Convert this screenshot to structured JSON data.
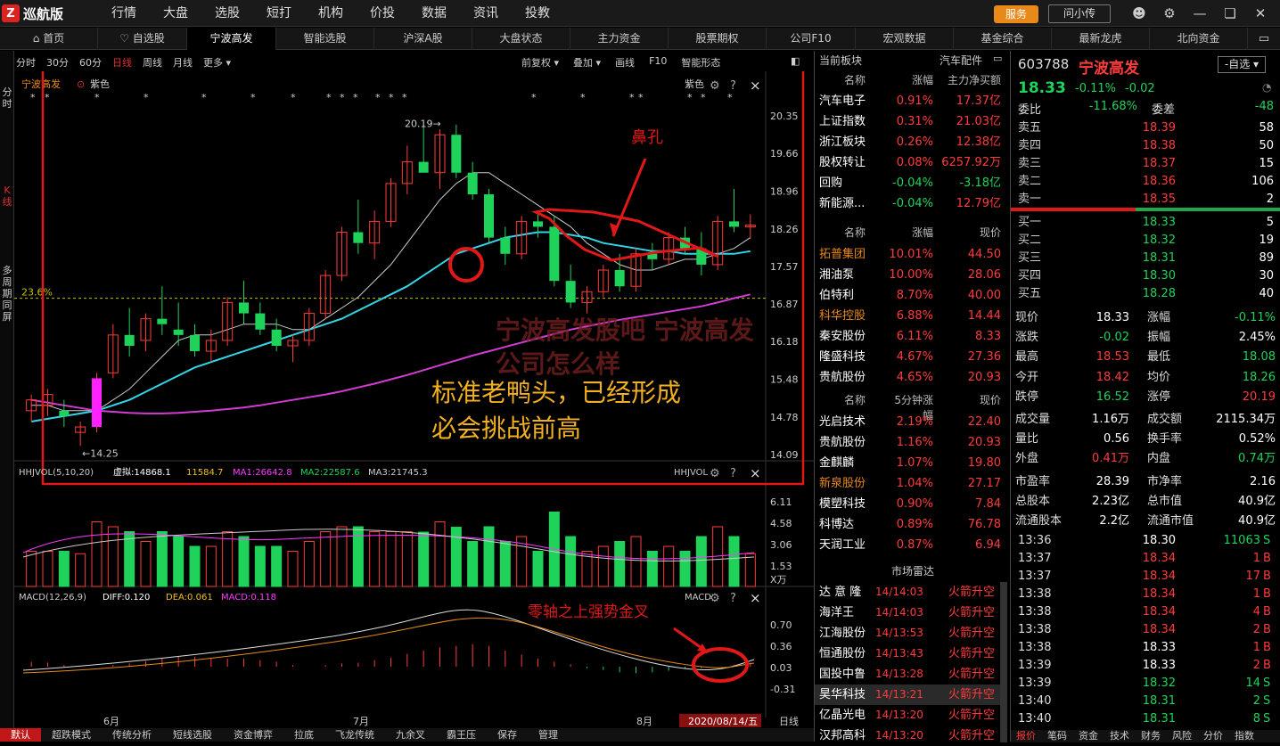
{
  "app": {
    "name": "巡航版",
    "menu": [
      "行情",
      "大盘",
      "选股",
      "短打",
      "机构",
      "价投",
      "数据",
      "资讯",
      "投教"
    ],
    "service": "服务",
    "ask": "问小传"
  },
  "tabs": [
    "首页",
    "自选股",
    "宁波高发",
    "智能选股",
    "沪深A股",
    "大盘状态",
    "主力资金",
    "股票期权",
    "公司F10",
    "宏观数据",
    "基金综合",
    "最新龙虎",
    "北向资金"
  ],
  "left_strip": [
    "分时",
    "K线",
    "多周期同屏"
  ],
  "chart_tools": {
    "periods": [
      "分时",
      "30分",
      "60分",
      "日线",
      "周线",
      "月线",
      "更多"
    ],
    "right": [
      "前复权",
      "叠加",
      "画线",
      "F10",
      "智能形态"
    ]
  },
  "main_chart": {
    "stock": "宁波高发",
    "color_label": "紫色",
    "color_label2": "紫色",
    "high_label": "20.19",
    "low_label": "14.25",
    "percent_label": "23.6%",
    "y_ticks": [
      "20.35",
      "19.66",
      "18.96",
      "18.26",
      "17.57",
      "16.87",
      "16.18",
      "15.48",
      "14.78",
      "14.09"
    ]
  },
  "vol_panel": {
    "title": "HHJVOL(5,10,20)",
    "xn": "虚拟:14868.1",
    "v1": "11584.7",
    "ma1": "MA1:26642.8",
    "ma2": "MA2:22587.6",
    "ma3": "MA3:21745.3",
    "right": "HHJVOL",
    "y_ticks": [
      "6.11",
      "4.58",
      "3.06",
      "1.53"
    ],
    "unit": "X万"
  },
  "macd_panel": {
    "title": "MACD(12,26,9)",
    "diff": "DIFF:0.120",
    "dea": "DEA:0.061",
    "macd": "MACD:0.118",
    "right": "MACD",
    "y_ticks": [
      "0.70",
      "0.36",
      "0.03",
      "-0.31"
    ]
  },
  "x_labels": [
    "6月",
    "7月",
    "8月"
  ],
  "date_label": "2020/08/14/五",
  "period_right": "日线",
  "annotations": {
    "nose": "鼻孔",
    "duckhead": "标准老鸭头，已经形成\n必会挑战前高",
    "watermark": "宁波高发股吧 宁波高发公司怎么样",
    "macd_note": "零轴之上强势金叉"
  },
  "chart_data": {
    "type": "candlestick",
    "dates": [
      "2020-05",
      "2020-06",
      "2020-07",
      "2020-08"
    ],
    "ohlc": [
      [
        14.9,
        15.2,
        14.7,
        15.1
      ],
      [
        15.0,
        15.3,
        14.8,
        15.2
      ],
      [
        14.9,
        15.1,
        14.6,
        14.8
      ],
      [
        14.5,
        14.7,
        14.25,
        14.6
      ],
      [
        14.6,
        15.6,
        14.5,
        15.5
      ],
      [
        15.6,
        16.5,
        15.5,
        16.3
      ],
      [
        16.3,
        16.8,
        15.9,
        16.1
      ],
      [
        16.2,
        16.7,
        16.0,
        16.6
      ],
      [
        16.6,
        17.2,
        16.3,
        16.5
      ],
      [
        16.4,
        16.9,
        16.1,
        16.3
      ],
      [
        16.3,
        16.5,
        15.9,
        16.0
      ],
      [
        16.0,
        16.4,
        15.8,
        16.2
      ],
      [
        16.2,
        17.0,
        16.1,
        16.9
      ],
      [
        16.9,
        17.3,
        16.5,
        16.7
      ],
      [
        16.7,
        16.9,
        16.3,
        16.4
      ],
      [
        16.4,
        16.6,
        16.0,
        16.1
      ],
      [
        16.1,
        16.3,
        15.8,
        16.2
      ],
      [
        16.2,
        16.8,
        16.1,
        16.7
      ],
      [
        16.7,
        17.5,
        16.6,
        17.4
      ],
      [
        17.4,
        18.3,
        17.3,
        18.2
      ],
      [
        18.2,
        18.8,
        17.8,
        18.0
      ],
      [
        18.0,
        18.6,
        17.7,
        18.4
      ],
      [
        18.4,
        19.2,
        18.3,
        19.1
      ],
      [
        19.1,
        19.8,
        18.9,
        19.5
      ],
      [
        19.5,
        20.19,
        19.3,
        19.3
      ],
      [
        19.3,
        20.1,
        19.0,
        20.0
      ],
      [
        20.0,
        20.19,
        19.2,
        19.3
      ],
      [
        19.3,
        19.5,
        18.8,
        18.9
      ],
      [
        18.9,
        19.0,
        18.0,
        18.1
      ],
      [
        18.1,
        18.3,
        17.6,
        17.8
      ],
      [
        17.8,
        18.5,
        17.7,
        18.4
      ],
      [
        18.4,
        18.6,
        18.1,
        18.3
      ],
      [
        18.3,
        18.5,
        17.2,
        17.3
      ],
      [
        17.3,
        17.6,
        16.8,
        16.9
      ],
      [
        16.9,
        17.2,
        16.7,
        17.1
      ],
      [
        17.1,
        17.6,
        17.0,
        17.5
      ],
      [
        17.5,
        17.8,
        17.1,
        17.2
      ],
      [
        17.2,
        17.9,
        17.1,
        17.8
      ],
      [
        17.8,
        18.0,
        17.5,
        17.7
      ],
      [
        17.7,
        18.2,
        17.6,
        18.1
      ],
      [
        18.1,
        18.3,
        17.8,
        17.9
      ],
      [
        17.9,
        18.2,
        17.4,
        17.6
      ],
      [
        17.6,
        18.5,
        17.5,
        18.4
      ],
      [
        18.4,
        19.0,
        18.2,
        18.3
      ],
      [
        18.3,
        18.53,
        18.08,
        18.33
      ]
    ],
    "ma_series": [
      {
        "color": "#cccccc",
        "values": [
          15.0,
          15.0,
          14.9,
          14.9,
          14.9,
          15.1,
          15.3,
          15.6,
          15.9,
          16.2,
          16.3,
          16.3,
          16.4,
          16.5,
          16.5,
          16.5,
          16.4,
          16.4,
          16.6,
          16.8,
          17.0,
          17.3,
          17.6,
          18.0,
          18.4,
          18.8,
          19.1,
          19.3,
          19.3,
          19.1,
          18.9,
          18.7,
          18.5,
          18.3,
          18.0,
          17.8,
          17.6,
          17.5,
          17.5,
          17.6,
          17.7,
          17.7,
          17.8,
          17.9,
          18.1
        ]
      },
      {
        "color": "#33d6e6",
        "values": [
          14.7,
          14.75,
          14.8,
          14.85,
          14.9,
          15.0,
          15.1,
          15.25,
          15.4,
          15.55,
          15.7,
          15.8,
          15.9,
          16.0,
          16.1,
          16.2,
          16.3,
          16.4,
          16.5,
          16.6,
          16.75,
          16.9,
          17.05,
          17.2,
          17.4,
          17.6,
          17.8,
          17.9,
          18.0,
          18.1,
          18.15,
          18.2,
          18.2,
          18.15,
          18.1,
          18.0,
          17.95,
          17.9,
          17.85,
          17.85,
          17.8,
          17.8,
          17.8,
          17.8,
          17.85
        ]
      },
      {
        "color": "#d23cd2",
        "values": [
          15.1,
          15.05,
          15.0,
          14.95,
          14.9,
          14.88,
          14.86,
          14.85,
          14.85,
          14.86,
          14.88,
          14.9,
          14.93,
          14.96,
          15.0,
          15.05,
          15.1,
          15.15,
          15.2,
          15.26,
          15.33,
          15.4,
          15.48,
          15.56,
          15.65,
          15.74,
          15.83,
          15.92,
          16.0,
          16.08,
          16.16,
          16.24,
          16.32,
          16.4,
          16.46,
          16.52,
          16.58,
          16.63,
          16.68,
          16.73,
          16.78,
          16.83,
          16.9,
          16.98,
          17.05
        ]
      }
    ],
    "ylim": [
      14.09,
      20.35
    ]
  },
  "blocks": {
    "head": [
      "当前板块",
      "汽车配件"
    ],
    "cols": [
      "名称",
      "涨幅",
      "主力净买额"
    ],
    "rows": [
      [
        "汽车电子",
        "0.91%",
        "17.37亿"
      ],
      [
        "上证指数",
        "0.31%",
        "21.03亿"
      ],
      [
        "浙江板块",
        "0.26%",
        "12.38亿"
      ],
      [
        "股权转让",
        "0.08%",
        "6257.92万"
      ],
      [
        "回购",
        "-0.04%",
        "-3.18亿"
      ],
      [
        "新能源...",
        "-0.04%",
        "12.79亿"
      ]
    ],
    "cols2": [
      "名称",
      "涨幅",
      "现价"
    ],
    "rows2": [
      [
        "拓普集团",
        "10.01%",
        "44.50"
      ],
      [
        "湘油泵",
        "10.00%",
        "28.06"
      ],
      [
        "伯特利",
        "8.70%",
        "40.00"
      ],
      [
        "科华控股",
        "6.88%",
        "14.44"
      ],
      [
        "秦安股份",
        "6.11%",
        "8.33"
      ],
      [
        "隆盛科技",
        "4.67%",
        "27.36"
      ],
      [
        "贵航股份",
        "4.65%",
        "20.93"
      ]
    ],
    "cols3": [
      "名称",
      "5分钟涨幅",
      "现价"
    ],
    "rows3": [
      [
        "光启技术",
        "2.19%",
        "22.40"
      ],
      [
        "贵航股份",
        "1.16%",
        "20.93"
      ],
      [
        "金麒麟",
        "1.07%",
        "19.80"
      ],
      [
        "新泉股份",
        "1.04%",
        "27.17"
      ],
      [
        "模塑科技",
        "0.90%",
        "7.84"
      ],
      [
        "科博达",
        "0.89%",
        "76.78"
      ],
      [
        "天润工业",
        "0.87%",
        "6.94"
      ]
    ],
    "radar_title": "市场雷达",
    "radar": [
      [
        "达 意 隆",
        "14/14:03",
        "火箭升空"
      ],
      [
        "海洋王",
        "14/14:03",
        "火箭升空"
      ],
      [
        "江海股份",
        "14/13:53",
        "火箭升空"
      ],
      [
        "恒通股份",
        "14/13:43",
        "火箭升空"
      ],
      [
        "国投中鲁",
        "14/13:28",
        "火箭升空"
      ],
      [
        "昊华科技",
        "14/13:21",
        "火箭升空"
      ],
      [
        "亿晶光电",
        "14/13:20",
        "火箭升空"
      ],
      [
        "汉邦高科",
        "14/13:20",
        "火箭升空"
      ]
    ]
  },
  "quote": {
    "code": "603788",
    "name": "宁波高发",
    "group": "自选",
    "price": "18.33",
    "chg_pct": "-0.11%",
    "chg": "-0.02",
    "wb_label": "委比",
    "wb": "-11.68%",
    "wc_label": "委差",
    "wc": "-48",
    "sells": [
      [
        "卖五",
        "18.39",
        "58"
      ],
      [
        "卖四",
        "18.38",
        "50"
      ],
      [
        "卖三",
        "18.37",
        "15"
      ],
      [
        "卖二",
        "18.36",
        "106"
      ],
      [
        "卖一",
        "18.35",
        "2"
      ]
    ],
    "buys": [
      [
        "买一",
        "18.33",
        "5"
      ],
      [
        "买二",
        "18.32",
        "19"
      ],
      [
        "买三",
        "18.31",
        "89"
      ],
      [
        "买四",
        "18.30",
        "30"
      ],
      [
        "买五",
        "18.28",
        "40"
      ]
    ],
    "stats": [
      [
        "现价",
        "18.33",
        "涨幅",
        "-0.11%"
      ],
      [
        "涨跌",
        "-0.02",
        "振幅",
        "2.45%"
      ],
      [
        "最高",
        "18.53",
        "最低",
        "18.08"
      ],
      [
        "今开",
        "18.42",
        "均价",
        "18.26"
      ],
      [
        "跌停",
        "16.52",
        "涨停",
        "20.19"
      ],
      [
        "成交量",
        "1.16万",
        "成交额",
        "2115.34万"
      ],
      [
        "量比",
        "0.56",
        "换手率",
        "0.52%"
      ],
      [
        "外盘",
        "0.41万",
        "内盘",
        "0.74万"
      ],
      [
        "市盈率",
        "28.39",
        "市净率",
        "2.16"
      ],
      [
        "总股本",
        "2.23亿",
        "总市值",
        "40.9亿"
      ],
      [
        "流通股本",
        "2.2亿",
        "流通市值",
        "40.9亿"
      ]
    ],
    "ticks": [
      [
        "13:36",
        "18.30",
        "11063",
        "S"
      ],
      [
        "13:37",
        "18.34",
        "1",
        "B"
      ],
      [
        "13:37",
        "18.34",
        "17",
        "B"
      ],
      [
        "13:38",
        "18.34",
        "1",
        "B"
      ],
      [
        "13:38",
        "18.34",
        "4",
        "B"
      ],
      [
        "13:38",
        "18.34",
        "2",
        "B"
      ],
      [
        "13:38",
        "18.33",
        "1",
        "B"
      ],
      [
        "13:39",
        "18.33",
        "2",
        "B"
      ],
      [
        "13:39",
        "18.32",
        "14",
        "S"
      ],
      [
        "13:40",
        "18.31",
        "2",
        "S"
      ],
      [
        "13:40",
        "18.31",
        "8",
        "S"
      ]
    ],
    "bottom_tabs": [
      "报价",
      "笔码",
      "资金",
      "技术",
      "财务",
      "风险",
      "分价",
      "指数"
    ]
  },
  "bottombar": [
    "默认",
    "超跌模式",
    "传统分析",
    "短线选股",
    "资金博弈",
    "拉底",
    "飞龙传统",
    "九余叉",
    "霸王压",
    "保存",
    "管理"
  ]
}
